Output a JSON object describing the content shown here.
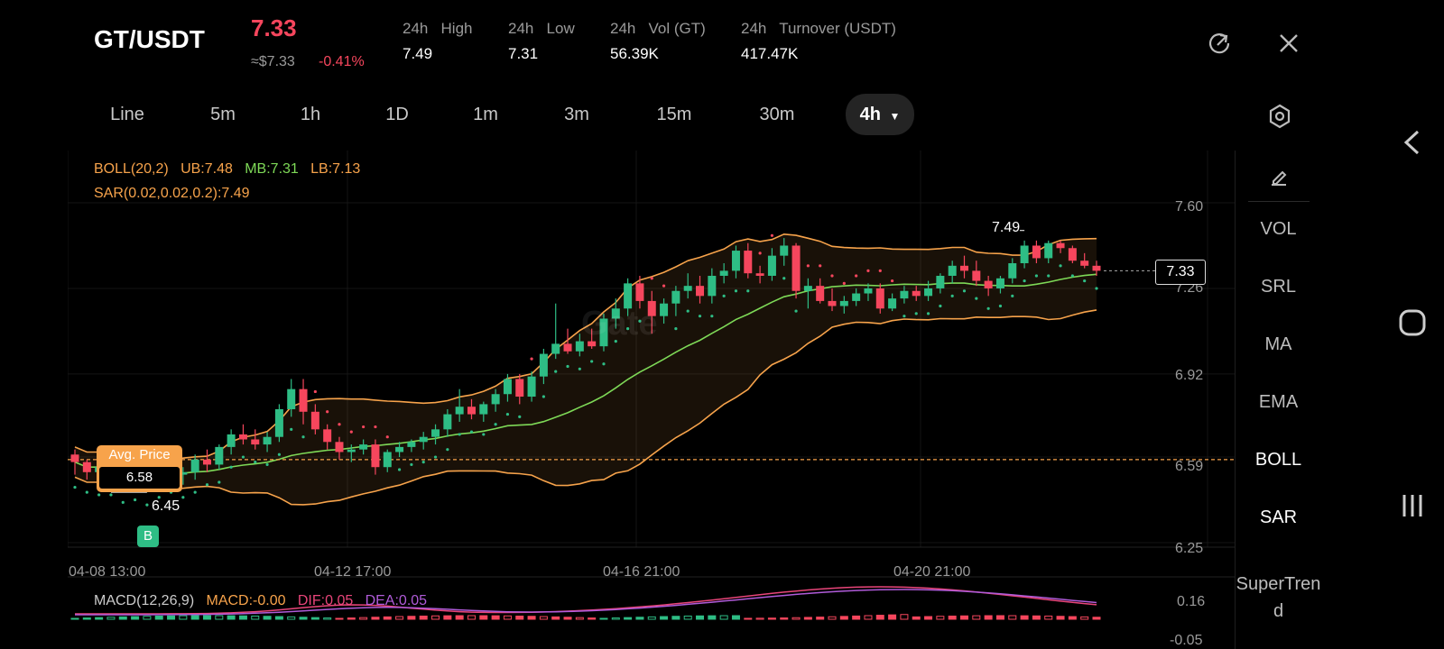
{
  "header": {
    "pair": "GT/USDT",
    "price": "7.33",
    "usd_price": "≈$7.33",
    "change": "-0.41%",
    "stats": [
      {
        "label": "24h   High",
        "value": "7.49"
      },
      {
        "label": "24h   Low",
        "value": "7.31"
      },
      {
        "label": "24h   Vol (GT)",
        "value": "56.39K"
      },
      {
        "label": "24h   Turnover (USDT)",
        "value": "417.47K"
      }
    ]
  },
  "intervals": [
    "Line",
    "5m",
    "1h",
    "1D",
    "1m",
    "3m",
    "15m",
    "30m",
    "4h"
  ],
  "active_interval": "4h",
  "indicators_text": {
    "boll": "BOLL(20,2)",
    "ub": "UB:7.48",
    "mb": "MB:7.31",
    "lb": "LB:7.13",
    "sar": "SAR(0.02,0.02,0.2):7.49",
    "macd": "MACD(12,26,9)",
    "macd_val": "MACD:-0.00",
    "dif": "DIF:0.05",
    "dea": "DEA:0.05"
  },
  "price_axis": [
    "7.60",
    "7.26",
    "6.92",
    "6.59",
    "6.25"
  ],
  "macd_axis": [
    "0.16",
    "-0.05"
  ],
  "time_axis": [
    "04-08 13:00",
    "04-12 17:00",
    "04-16 21:00",
    "04-20 21:00"
  ],
  "avg_price": {
    "label": "Avg. Price",
    "value": "6.58"
  },
  "marker_low": "6.45",
  "marker_high": "7.49",
  "current_tag": "7.33",
  "buy_badge": "B",
  "watermark": "Gate",
  "side_menu": [
    "VOL",
    "SRL",
    "MA",
    "EMA",
    "BOLL",
    "SAR",
    "SuperTrend"
  ],
  "side_active": [
    "BOLL",
    "SAR"
  ],
  "colors": {
    "up": "#2ebd85",
    "down": "#f6465d",
    "boll_ub": "#f7a34b",
    "boll_mb": "#7ed957",
    "sar": "#f6465d",
    "dif": "#e8457a",
    "dea": "#b05bd9"
  },
  "chart_data": {
    "type": "candlestick",
    "price_range": [
      6.25,
      7.6
    ],
    "candles": [
      [
        6.6,
        6.62,
        6.52,
        6.57
      ],
      [
        6.57,
        6.58,
        6.5,
        6.53
      ],
      [
        6.53,
        6.56,
        6.49,
        6.55
      ],
      [
        6.55,
        6.57,
        6.49,
        6.5
      ],
      [
        6.5,
        6.54,
        6.46,
        6.52
      ],
      [
        6.52,
        6.55,
        6.47,
        6.49
      ],
      [
        6.49,
        6.53,
        6.45,
        6.51
      ],
      [
        6.51,
        6.56,
        6.48,
        6.54
      ],
      [
        6.54,
        6.57,
        6.5,
        6.52
      ],
      [
        6.52,
        6.55,
        6.48,
        6.53
      ],
      [
        6.53,
        6.6,
        6.5,
        6.58
      ],
      [
        6.58,
        6.62,
        6.53,
        6.56
      ],
      [
        6.56,
        6.64,
        6.54,
        6.63
      ],
      [
        6.63,
        6.7,
        6.6,
        6.68
      ],
      [
        6.68,
        6.72,
        6.64,
        6.66
      ],
      [
        6.66,
        6.7,
        6.62,
        6.64
      ],
      [
        6.64,
        6.69,
        6.61,
        6.67
      ],
      [
        6.67,
        6.8,
        6.65,
        6.78
      ],
      [
        6.78,
        6.9,
        6.75,
        6.86
      ],
      [
        6.86,
        6.9,
        6.72,
        6.77
      ],
      [
        6.77,
        6.8,
        6.68,
        6.7
      ],
      [
        6.7,
        6.72,
        6.62,
        6.65
      ],
      [
        6.65,
        6.67,
        6.58,
        6.61
      ],
      [
        6.61,
        6.64,
        6.57,
        6.62
      ],
      [
        6.62,
        6.66,
        6.6,
        6.64
      ],
      [
        6.64,
        6.66,
        6.52,
        6.55
      ],
      [
        6.55,
        6.62,
        6.53,
        6.61
      ],
      [
        6.61,
        6.65,
        6.59,
        6.63
      ],
      [
        6.63,
        6.66,
        6.61,
        6.65
      ],
      [
        6.65,
        6.69,
        6.62,
        6.67
      ],
      [
        6.67,
        6.72,
        6.64,
        6.7
      ],
      [
        6.7,
        6.78,
        6.67,
        6.76
      ],
      [
        6.76,
        6.86,
        6.73,
        6.79
      ],
      [
        6.79,
        6.82,
        6.74,
        6.76
      ],
      [
        6.76,
        6.81,
        6.73,
        6.8
      ],
      [
        6.8,
        6.86,
        6.77,
        6.84
      ],
      [
        6.84,
        6.92,
        6.81,
        6.9
      ],
      [
        6.9,
        6.92,
        6.8,
        6.83
      ],
      [
        6.83,
        6.93,
        6.81,
        6.91
      ],
      [
        6.91,
        7.02,
        6.88,
        7.0
      ],
      [
        7.0,
        7.2,
        6.98,
        7.04
      ],
      [
        7.04,
        7.1,
        7.0,
        7.01
      ],
      [
        7.01,
        7.08,
        6.99,
        7.05
      ],
      [
        7.05,
        7.1,
        7.02,
        7.03
      ],
      [
        7.03,
        7.16,
        7.01,
        7.14
      ],
      [
        7.14,
        7.22,
        7.1,
        7.18
      ],
      [
        7.18,
        7.3,
        7.15,
        7.28
      ],
      [
        7.28,
        7.31,
        7.18,
        7.21
      ],
      [
        7.21,
        7.25,
        7.08,
        7.15
      ],
      [
        7.15,
        7.22,
        7.12,
        7.2
      ],
      [
        7.2,
        7.27,
        7.15,
        7.25
      ],
      [
        7.25,
        7.32,
        7.22,
        7.27
      ],
      [
        7.27,
        7.31,
        7.2,
        7.23
      ],
      [
        7.23,
        7.34,
        7.2,
        7.31
      ],
      [
        7.31,
        7.36,
        7.28,
        7.33
      ],
      [
        7.33,
        7.43,
        7.3,
        7.41
      ],
      [
        7.41,
        7.44,
        7.3,
        7.32
      ],
      [
        7.32,
        7.35,
        7.28,
        7.31
      ],
      [
        7.31,
        7.42,
        7.29,
        7.39
      ],
      [
        7.39,
        7.46,
        7.35,
        7.43
      ],
      [
        7.43,
        7.44,
        7.22,
        7.25
      ],
      [
        7.25,
        7.3,
        7.18,
        7.27
      ],
      [
        7.27,
        7.3,
        7.2,
        7.21
      ],
      [
        7.21,
        7.26,
        7.17,
        7.19
      ],
      [
        7.19,
        7.23,
        7.16,
        7.21
      ],
      [
        7.21,
        7.26,
        7.19,
        7.24
      ],
      [
        7.24,
        7.28,
        7.21,
        7.26
      ],
      [
        7.26,
        7.28,
        7.16,
        7.18
      ],
      [
        7.18,
        7.24,
        7.17,
        7.22
      ],
      [
        7.22,
        7.27,
        7.2,
        7.25
      ],
      [
        7.25,
        7.27,
        7.21,
        7.23
      ],
      [
        7.23,
        7.29,
        7.21,
        7.26
      ],
      [
        7.26,
        7.32,
        7.24,
        7.31
      ],
      [
        7.31,
        7.37,
        7.28,
        7.35
      ],
      [
        7.35,
        7.39,
        7.3,
        7.33
      ],
      [
        7.33,
        7.37,
        7.27,
        7.29
      ],
      [
        7.29,
        7.31,
        7.23,
        7.26
      ],
      [
        7.26,
        7.31,
        7.24,
        7.3
      ],
      [
        7.3,
        7.38,
        7.28,
        7.36
      ],
      [
        7.36,
        7.45,
        7.34,
        7.43
      ],
      [
        7.43,
        7.45,
        7.36,
        7.38
      ],
      [
        7.38,
        7.45,
        7.36,
        7.44
      ],
      [
        7.44,
        7.45,
        7.4,
        7.42
      ],
      [
        7.42,
        7.43,
        7.36,
        7.37
      ],
      [
        7.37,
        7.4,
        7.34,
        7.35
      ],
      [
        7.35,
        7.37,
        7.31,
        7.33
      ]
    ]
  }
}
